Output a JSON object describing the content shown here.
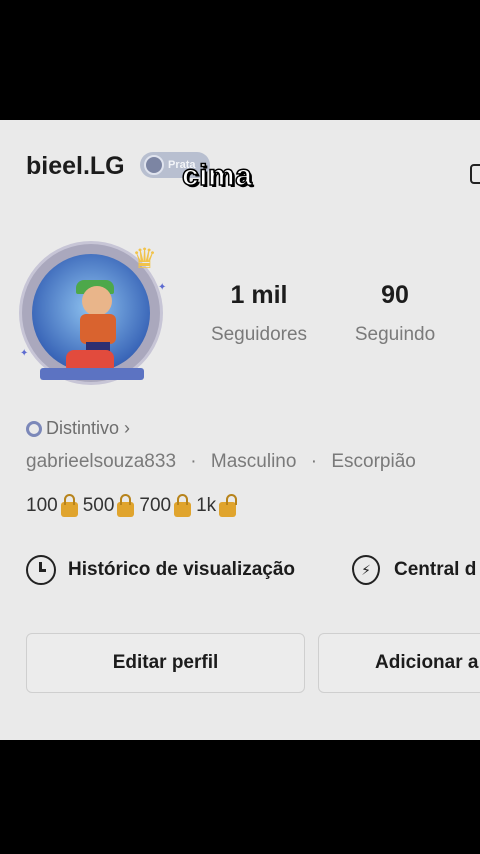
{
  "profile": {
    "username": "bieel.LG",
    "badge_label": "Prata",
    "overlay_text": "cima",
    "distintivo_label": "Distintivo",
    "distintivo_chevron": "›",
    "handle": "gabrieelsouza833",
    "gender": "Masculino",
    "sign": "Escorpião",
    "separator": "·"
  },
  "stats": [
    {
      "value": "1 mil",
      "label": "Seguidores"
    },
    {
      "value": "90",
      "label": "Seguindo"
    }
  ],
  "milestones": [
    "100",
    "500",
    "700",
    "1k"
  ],
  "shortcuts": {
    "history": "Histórico de visualização",
    "central": "Central d"
  },
  "buttons": {
    "edit": "Editar perfil",
    "add": "Adicionar a"
  },
  "colors": {
    "background": "#000000",
    "panel": "#eaeaea",
    "badge": "#b8bfd0",
    "lock": "#e0a42d"
  },
  "icons": [
    "prata-badge-icon",
    "clock-icon",
    "bolt-icon",
    "lock-icon",
    "crown-icon",
    "distintivo-icon"
  ]
}
